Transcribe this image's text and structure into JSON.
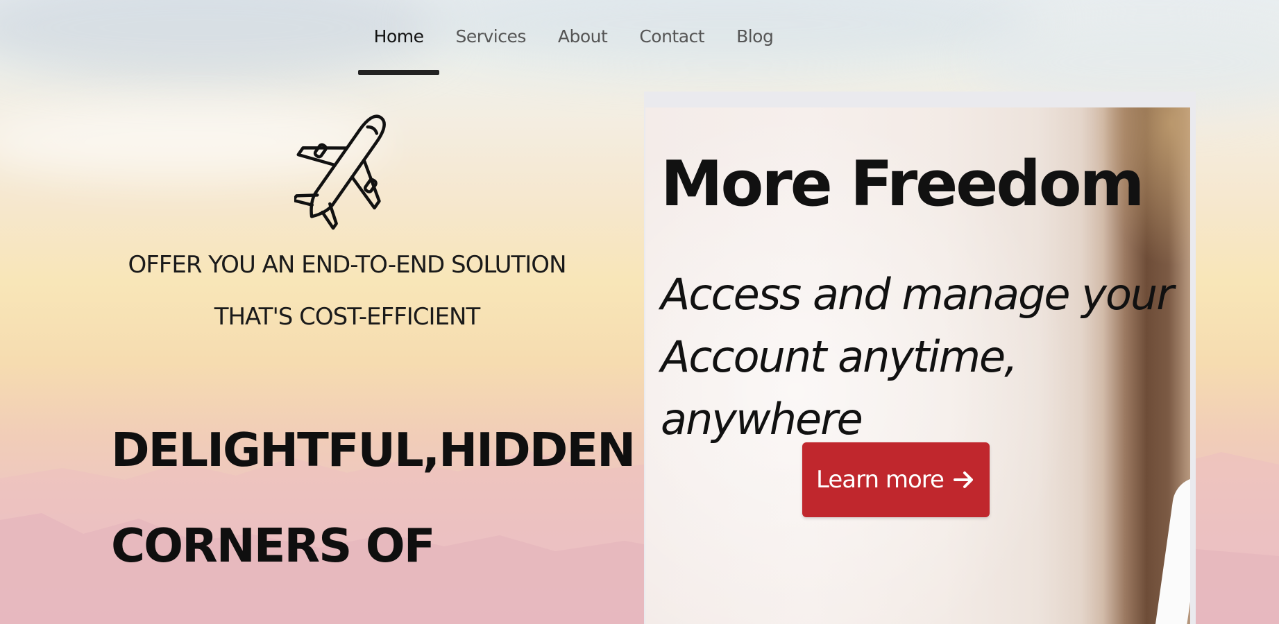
{
  "nav": {
    "items": [
      {
        "label": "Home",
        "active": true
      },
      {
        "label": "Services",
        "active": false
      },
      {
        "label": "About",
        "active": false
      },
      {
        "label": "Contact",
        "active": false
      },
      {
        "label": "Blog",
        "active": false
      }
    ]
  },
  "hero": {
    "icon": "airplane-icon",
    "tagline_line1": "OFFER YOU AN END-TO-END SOLUTION",
    "tagline_line2": "THAT'S COST-EFFICIENT",
    "headline_line1": "DELIGHTFUL,HIDDEN",
    "headline_line2": "CORNERS OF"
  },
  "card": {
    "title": "More Freedom",
    "subtitle_line1": "Access and manage your",
    "subtitle_line2": "Account anytime, anywhere",
    "button_label": "Learn more",
    "button_icon": "arrow-right-icon",
    "button_color": "#c0272d"
  }
}
